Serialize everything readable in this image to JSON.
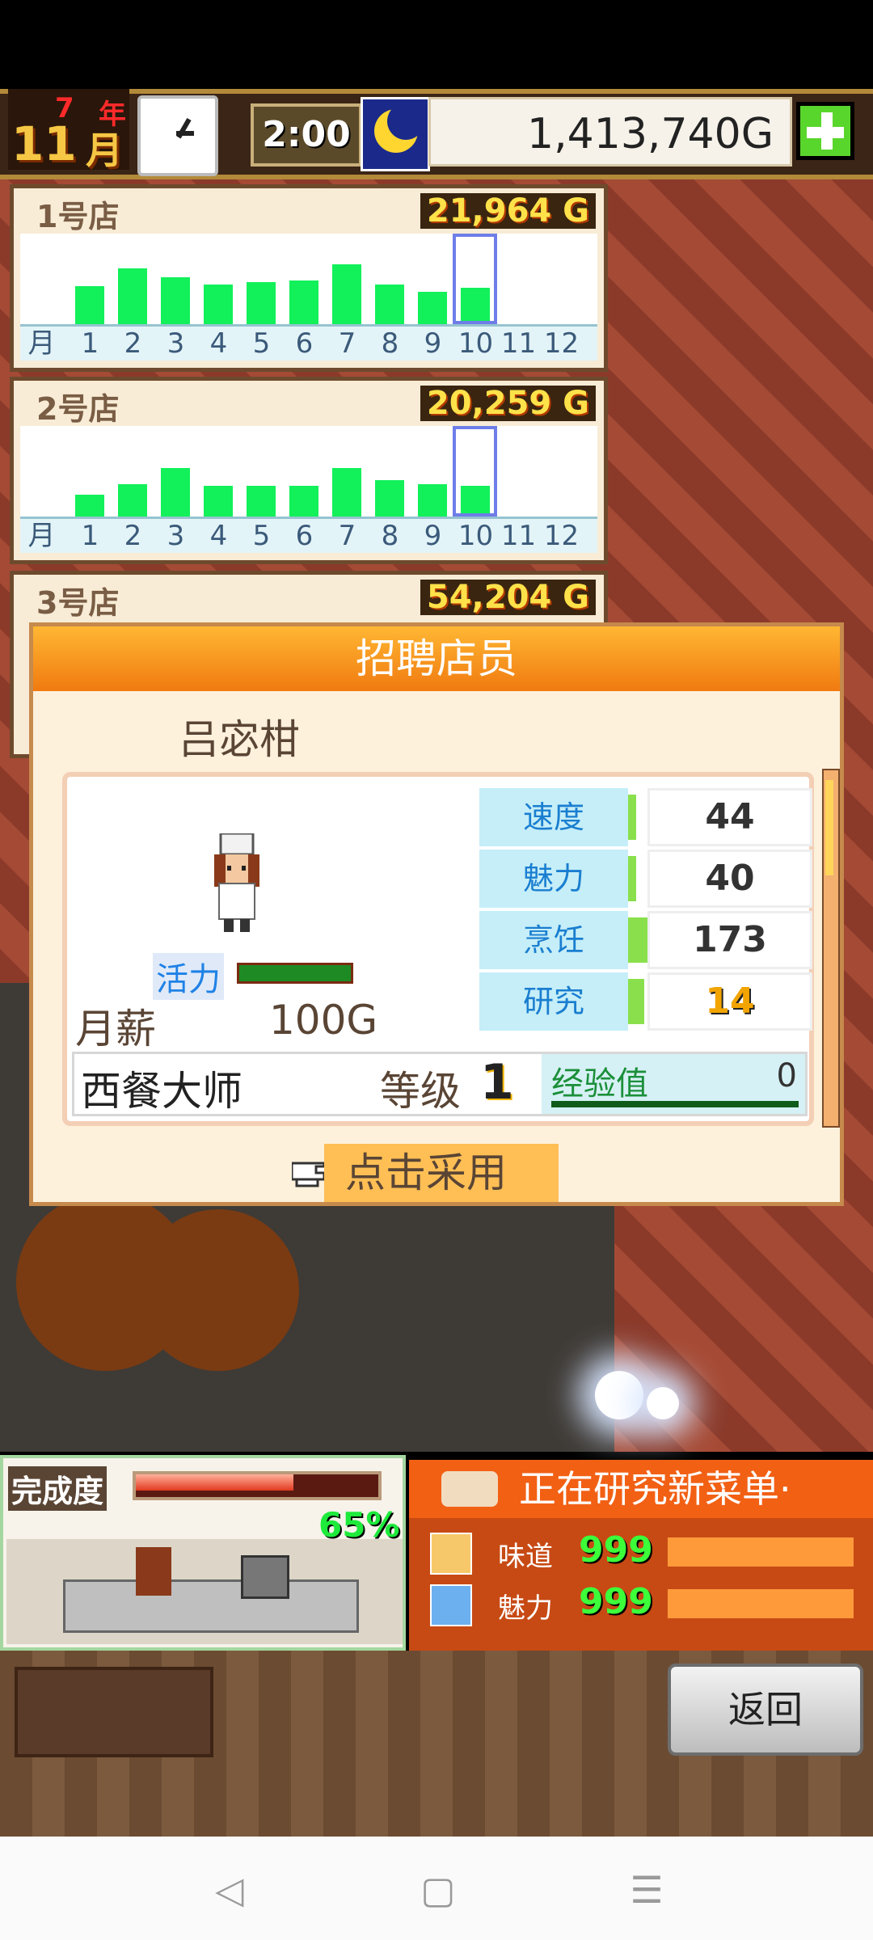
{
  "hud": {
    "year_num": "7",
    "year_label": "年",
    "month_num": "11",
    "month_label": "月",
    "time": "2:00",
    "money": "1,413,740G"
  },
  "shops": [
    {
      "name": "1号店",
      "total": "21,964 G",
      "bars": [
        0.42,
        0.62,
        0.52,
        0.44,
        0.46,
        0.48,
        0.66,
        0.44,
        0.36,
        0.4,
        0,
        0
      ]
    },
    {
      "name": "2号店",
      "total": "20,259 G",
      "bars": [
        0.24,
        0.36,
        0.54,
        0.34,
        0.34,
        0.34,
        0.54,
        0.4,
        0.36,
        0.34,
        0,
        0
      ]
    },
    {
      "name": "3号店",
      "total": "54,204 G"
    }
  ],
  "axis": {
    "month_label": "月",
    "ticks": [
      "1",
      "2",
      "3",
      "4",
      "5",
      "6",
      "7",
      "8",
      "9",
      "10",
      "11",
      "12"
    ],
    "highlight_index": 9
  },
  "dialog": {
    "title": "招聘店员",
    "employee_name": "吕宓柑",
    "vitality_label": "活力",
    "salary_label": "月薪",
    "salary": "100G",
    "stats": [
      {
        "name": "速度",
        "value": "44",
        "fill": 0.05
      },
      {
        "name": "魅力",
        "value": "40",
        "fill": 0.05
      },
      {
        "name": "烹饪",
        "value": "173",
        "fill": 0.2
      },
      {
        "name": "研究",
        "value": "14",
        "fill": 0.1
      }
    ],
    "job": "西餐大师",
    "level_label": "等级",
    "level": "1",
    "exp_label": "经验值",
    "exp_value": "0",
    "hire_button": "点击采用"
  },
  "progress": {
    "label": "完成度",
    "percent": "65%",
    "fill": 0.65
  },
  "research": {
    "title": "正在研究新菜单·",
    "rows": [
      {
        "name": "味道",
        "value": "999",
        "icon": "taste-icon"
      },
      {
        "name": "魅力",
        "value": "999",
        "icon": "charm-icon"
      }
    ]
  },
  "buttons": {
    "back": "返回"
  },
  "nav": {
    "back": "◁",
    "home": "▢",
    "menu": "☰"
  }
}
